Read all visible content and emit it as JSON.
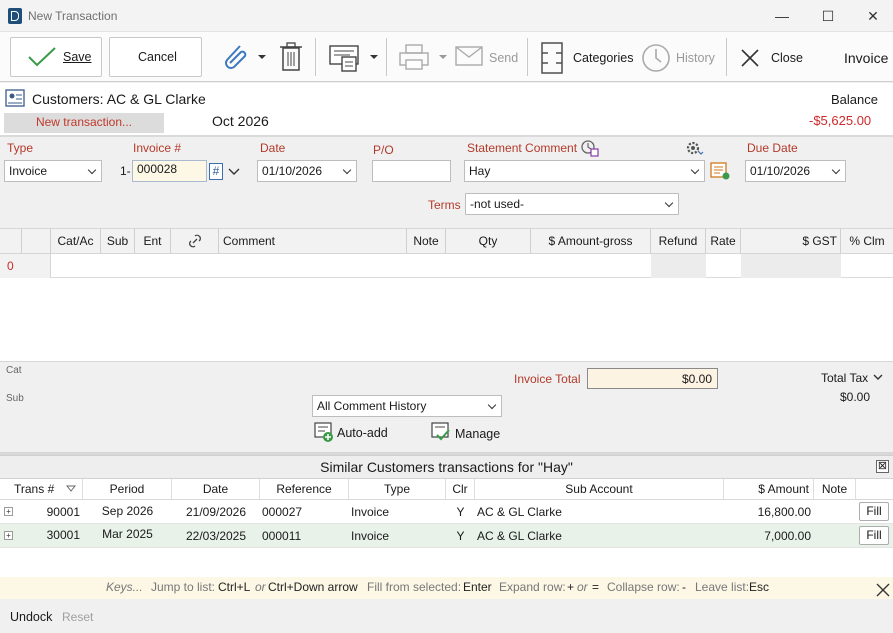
{
  "window": {
    "title": "New Transaction",
    "minimize": "—",
    "maximize": "☐",
    "close": "✕"
  },
  "toolbar": {
    "save": "Save",
    "cancel": "Cancel",
    "send": "Send",
    "categories": "Categories",
    "history": "History",
    "close": "Close",
    "mode": "Invoice"
  },
  "header": {
    "customer": "Customers: AC & GL Clarke",
    "tab": "New transaction...",
    "period": "Oct 2026",
    "balance_label": "Balance",
    "balance_value": "-$5,625.00"
  },
  "fields": {
    "type_label": "Type",
    "type_value": "Invoice",
    "invoice_label": "Invoice #",
    "invoice_prefix": "1-",
    "invoice_value": "000028",
    "hash": "#",
    "date_label": "Date",
    "date_value": "01/10/2026",
    "po_label": "P/O",
    "po_value": "",
    "statement_label": "Statement Comment",
    "statement_value": "Hay",
    "due_label": "Due Date",
    "due_value": "01/10/2026",
    "terms_label": "Terms",
    "terms_value": "-not used-"
  },
  "grid": {
    "columns": [
      "Cat/Ac",
      "Sub",
      "Ent",
      "",
      "Comment",
      "Note",
      "Qty",
      "$ Amount-gross",
      "Refund",
      "Rate",
      "$ GST",
      "% Clm"
    ],
    "row_number": "0"
  },
  "totals": {
    "cat_label": "Cat",
    "sub_label": "Sub",
    "invoice_total_label": "Invoice Total",
    "invoice_total_value": "$0.00",
    "total_tax_label": "Total Tax",
    "total_tax_value": "$0.00",
    "comment_history": "All Comment History",
    "auto_add": "Auto-add",
    "manage": "Manage"
  },
  "similar": {
    "title": "Similar Customers transactions for \"Hay\"",
    "columns": [
      "Trans #",
      "Period",
      "Date",
      "Reference",
      "Type",
      "Clr",
      "Sub Account",
      "$ Amount",
      "Note"
    ],
    "rows": [
      {
        "trans": "90001",
        "period": "Sep 2026",
        "date": "21/09/2026",
        "reference": "000027",
        "type": "Invoice",
        "clr": "Y",
        "sub_account": "AC & GL Clarke",
        "amount": "16,800.00",
        "note": "",
        "fill": "Fill"
      },
      {
        "trans": "30001",
        "period": "Mar 2025",
        "date": "22/03/2025",
        "reference": "000011",
        "type": "Invoice",
        "clr": "Y",
        "sub_account": "AC & GL Clarke",
        "amount": "7,000.00",
        "note": "",
        "fill": "Fill"
      }
    ]
  },
  "keys": {
    "label": "Keys...",
    "jump": "Jump to list:",
    "jump_key1": "Ctrl+L",
    "or1": "or",
    "jump_key2": "Ctrl+Down arrow",
    "fill": "Fill from selected:",
    "fill_key": "Enter",
    "expand": "Expand row:",
    "expand_key1": "+",
    "or2": "or",
    "expand_key2": "=",
    "collapse": "Collapse row:",
    "collapse_key": "-",
    "leave": "Leave list:",
    "leave_key": "Esc"
  },
  "bottom": {
    "undock": "Undock",
    "reset": "Reset"
  },
  "colors": {
    "accent_red": "#cc2a2a",
    "label_red": "#b33a2a",
    "save_check": "#3a9a4a"
  }
}
